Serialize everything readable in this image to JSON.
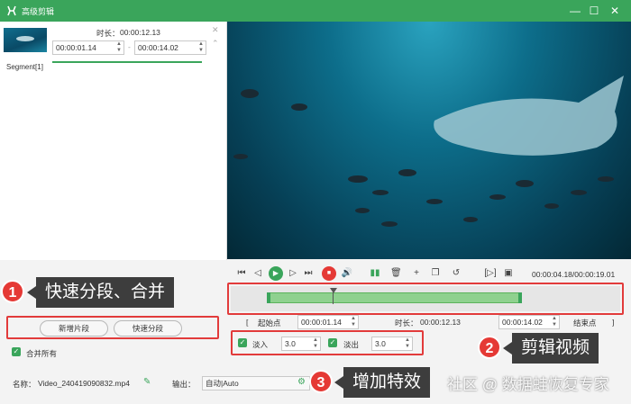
{
  "window": {
    "title": "高级剪辑",
    "controls": [
      "—",
      "☐",
      "✕"
    ]
  },
  "segment": {
    "duration_label": "时长：",
    "duration_value": "00:00:12.13",
    "start": "00:00:01.14",
    "dash": "-",
    "end": "00:00:14.02",
    "name": "Segment[1]"
  },
  "buttons": {
    "new_segment": "新增片段",
    "quick_split": "快速分段",
    "merge_all": "合并所有"
  },
  "file": {
    "name_label": "名称：",
    "name_value": "Video_240419090832.mp4",
    "output_label": "输出：",
    "output_value": "自动|Auto"
  },
  "player": {
    "time": "00:00:04.18/00:00:19.01"
  },
  "range": {
    "start_label": "起始点",
    "start_bracket": "[",
    "start_value": "00:00:01.14",
    "duration_label": "时长：",
    "duration_value": "00:00:12.13",
    "end_value": "00:00:14.02",
    "end_label": "结束点",
    "end_bracket": "]"
  },
  "effects": {
    "fade_in_label": "淡入",
    "fade_in_value": "3.0",
    "fade_out_label": "淡出",
    "fade_out_value": "3.0"
  },
  "annotations": {
    "one": {
      "num": "1",
      "text": "快速分段、合并"
    },
    "two": {
      "num": "2",
      "text": "剪辑视频"
    },
    "three": {
      "num": "3",
      "text": "增加特效"
    }
  },
  "watermark": "社区 @ 数据蛙恢复专家",
  "colors": {
    "brand": "#3aa55b",
    "annotation": "#e53935",
    "callout": "#3d3d3d"
  }
}
